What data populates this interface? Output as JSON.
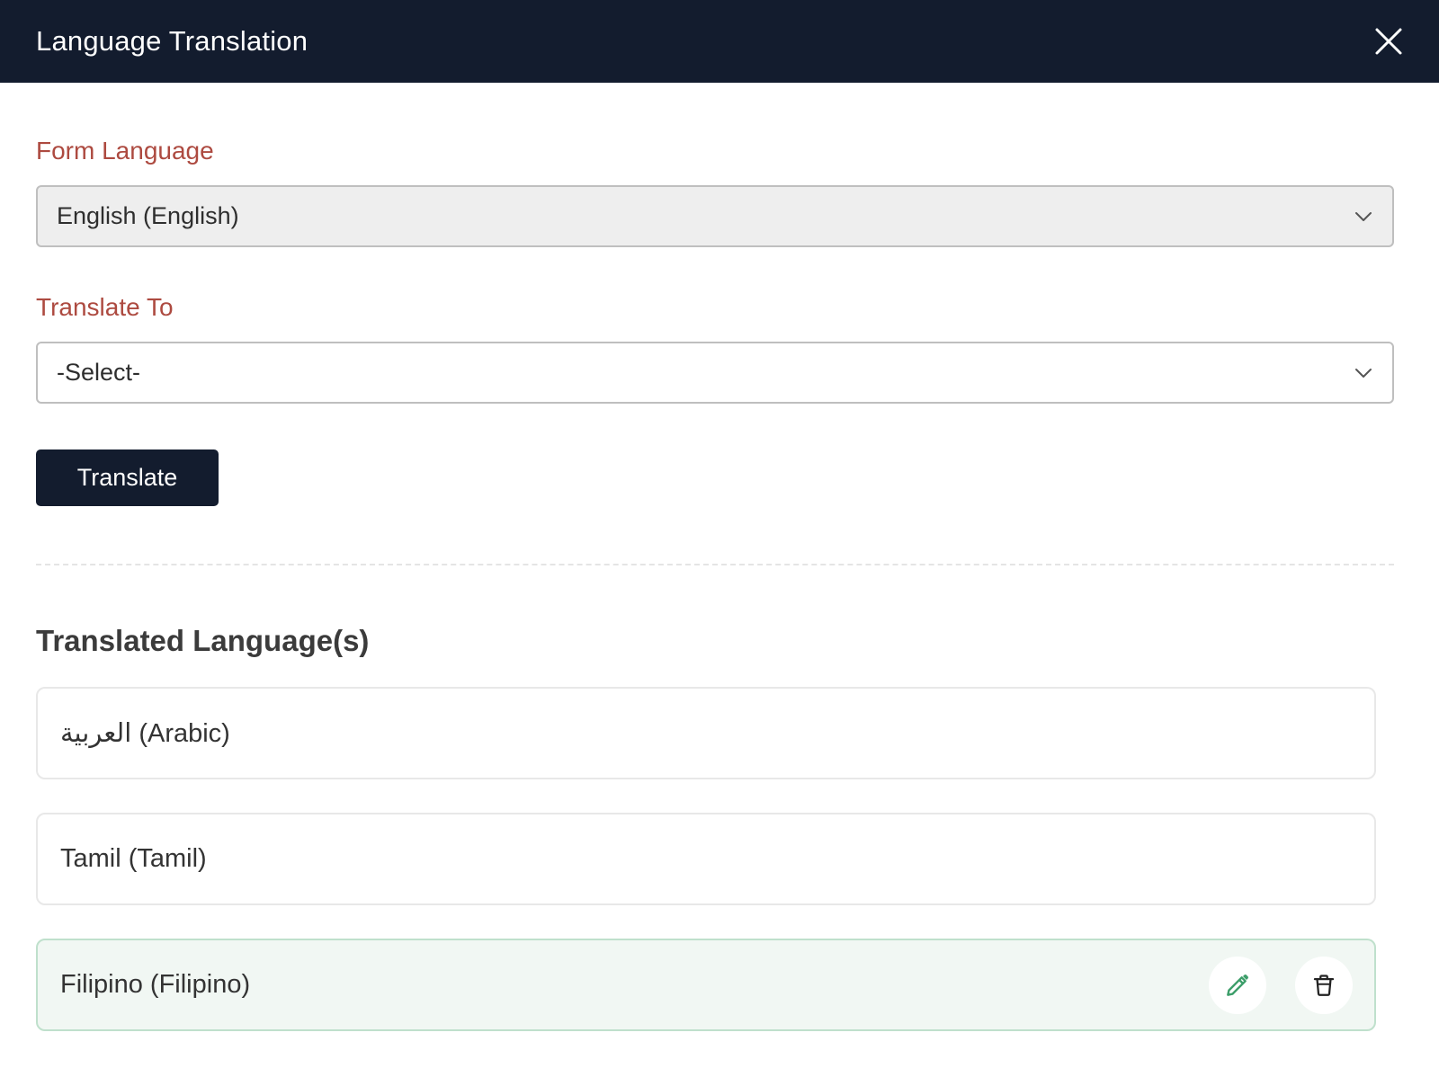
{
  "dialog": {
    "title": "Language Translation"
  },
  "form_language": {
    "label": "Form Language",
    "value": "English (English)"
  },
  "translate_to": {
    "label": "Translate To",
    "value": "-Select-"
  },
  "actions": {
    "translate_label": "Translate"
  },
  "translated": {
    "title": "Translated Language(s)",
    "items": [
      {
        "label": "العربية (Arabic)"
      },
      {
        "label": "Tamil (Tamil)"
      },
      {
        "label": "Filipino (Filipino)"
      }
    ]
  },
  "colors": {
    "header_bg": "#131c2e",
    "label_accent": "#ad4a40",
    "edit_icon": "#3d9e6a",
    "active_card_bg": "#f1f7f3"
  },
  "icons": {
    "close": "close-icon",
    "dropdown": "chevron-down-icon",
    "edit": "pencil-icon",
    "delete": "trash-icon"
  }
}
